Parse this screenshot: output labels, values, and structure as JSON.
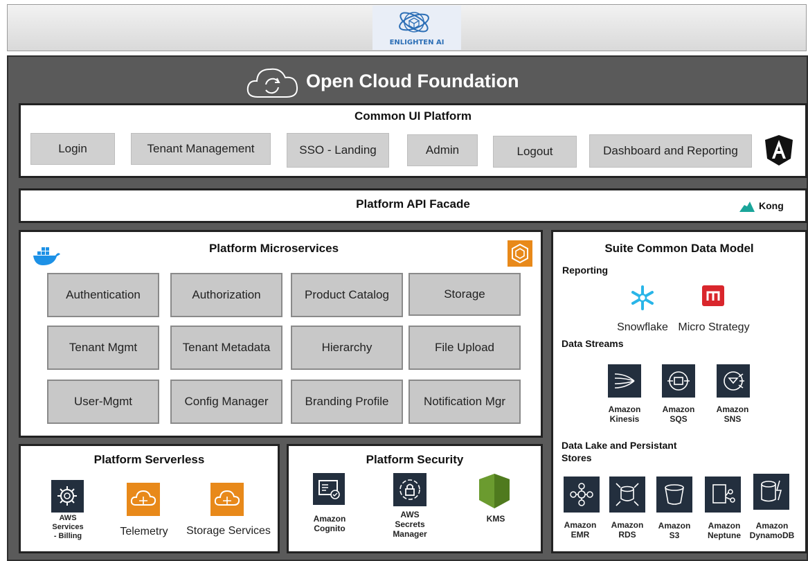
{
  "header": {
    "logo_text": "ENLIGHTEN AI"
  },
  "main_title": "Open Cloud Foundation",
  "ui_platform": {
    "title": "Common UI Platform",
    "buttons": [
      "Login",
      "Tenant Management",
      "SSO - Landing",
      "Admin",
      "Logout",
      "Dashboard and Reporting"
    ],
    "icon": "angular-icon"
  },
  "api_facade": {
    "title": "Platform API Facade",
    "brand": "Kong",
    "icon": "kong-icon"
  },
  "microservices": {
    "title": "Platform Microservices",
    "items": [
      "Authentication",
      "Authorization",
      "Product Catalog",
      "Storage",
      "Tenant Mgmt",
      "Tenant Metadata",
      "Hierarchy",
      "File Upload",
      "User-Mgmt",
      "Config Manager",
      "Branding Profile",
      "Notification Mgr"
    ]
  },
  "serverless": {
    "title": "Platform Serverless",
    "items": [
      {
        "label_lines": [
          "AWS",
          "Services",
          "- Billing"
        ],
        "icon": "aws-billing-icon"
      },
      {
        "label": "Telemetry",
        "icon": "telemetry-cloud-icon"
      },
      {
        "label": "Storage Services",
        "icon": "storage-cloud-icon"
      }
    ]
  },
  "security": {
    "title": "Platform Security",
    "items": [
      {
        "label_lines": [
          "Amazon",
          "Cognito"
        ],
        "icon": "cognito-icon"
      },
      {
        "label_lines": [
          "AWS",
          "Secrets",
          "Manager"
        ],
        "icon": "secrets-manager-icon"
      },
      {
        "label": "KMS",
        "icon": "kms-shield-icon"
      }
    ]
  },
  "data_model": {
    "title": "Suite Common Data Model",
    "reporting": {
      "heading": "Reporting",
      "items": [
        "Snowflake",
        "Micro Strategy"
      ]
    },
    "streams": {
      "heading": "Data Streams",
      "items": [
        [
          "Amazon",
          "Kinesis"
        ],
        [
          "Amazon",
          "SQS"
        ],
        [
          "Amazon",
          "SNS"
        ]
      ]
    },
    "lake": {
      "heading_lines": [
        "Data Lake and Persistant",
        "Stores"
      ],
      "items": [
        [
          "Amazon",
          "EMR"
        ],
        [
          "Amazon",
          "RDS"
        ],
        [
          "Amazon",
          "S3"
        ],
        [
          "Amazon",
          "Neptune"
        ],
        [
          "Amazon",
          "DynamoDB"
        ]
      ]
    }
  },
  "colors": {
    "frame": "#5a5a5a",
    "button": "#d0d0d0",
    "aws_dark": "#232f3e",
    "aws_orange": "#e8891a",
    "kms_green": "#6b9b2f"
  }
}
